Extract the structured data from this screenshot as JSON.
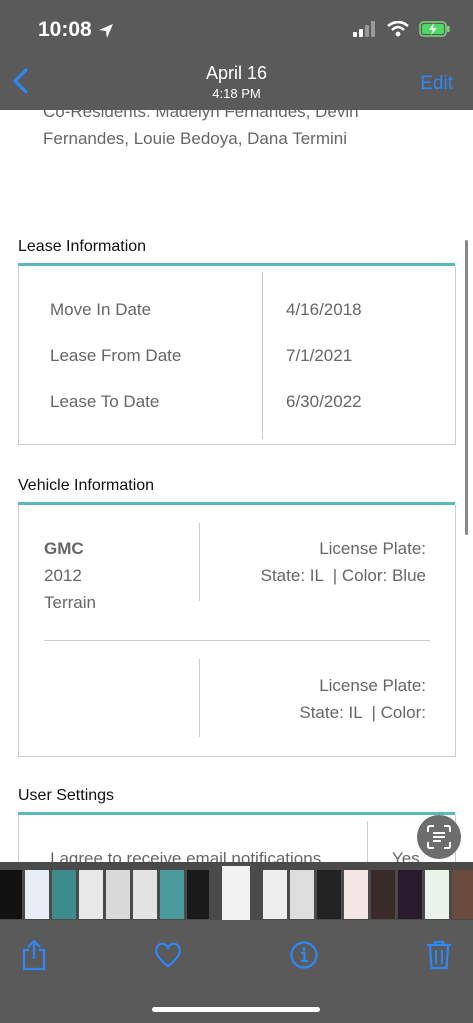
{
  "status_bar": {
    "time": "10:08"
  },
  "nav": {
    "title": "April 16",
    "subtitle": "4:18 PM",
    "edit_label": "Edit"
  },
  "co_residents": {
    "text": "Co-Residents: Madelyn Fernandes, Devin Fernandes, Louie Bedoya, Dana Termini"
  },
  "lease": {
    "title": "Lease Information",
    "rows": [
      {
        "label": "Move In Date",
        "value": "4/16/2018"
      },
      {
        "label": "Lease From Date",
        "value": "7/1/2021"
      },
      {
        "label": "Lease To Date",
        "value": "6/30/2022"
      }
    ]
  },
  "vehicle": {
    "title": "Vehicle Information",
    "vehicles": [
      {
        "make": "GMC",
        "year": "2012",
        "model": "Terrain",
        "plate": "License Plate:",
        "state_color": "State: IL  | Color: Blue"
      },
      {
        "plate": "License Plate:",
        "state_color": "State: IL  | Color:"
      }
    ]
  },
  "user_settings": {
    "title": "User Settings",
    "email_notice": "I agree to receive email notifications",
    "email_value": "Yes"
  },
  "colors": {
    "accent": "#2f86f5",
    "teal": "#5bb8bb",
    "chrome": "#5a5a5a"
  },
  "icons": [
    "location-arrow-icon",
    "signal-icon",
    "wifi-icon",
    "battery-charging-icon",
    "back-chevron-icon",
    "live-text-icon",
    "share-icon",
    "heart-icon",
    "info-icon",
    "trash-icon"
  ]
}
